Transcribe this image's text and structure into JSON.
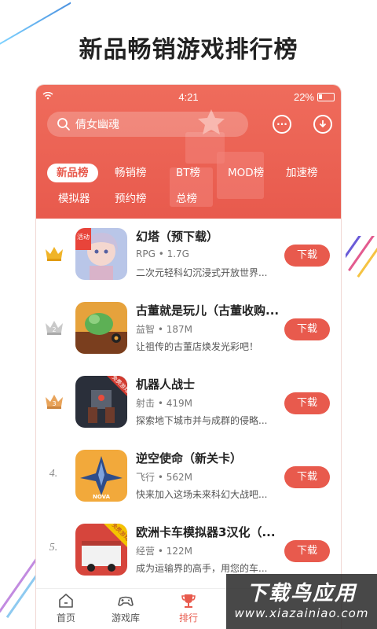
{
  "headline": "新品畅销游戏排行榜",
  "statusbar": {
    "time": "4:21",
    "battery": "22%"
  },
  "search": {
    "placeholder": "倩女幽魂"
  },
  "tabs": [
    {
      "label": "新品榜",
      "active": true
    },
    {
      "label": "畅销榜",
      "active": false
    },
    {
      "label": "BT榜",
      "active": false
    },
    {
      "label": "MOD榜",
      "active": false
    },
    {
      "label": "加速榜",
      "active": false
    },
    {
      "label": "模拟器",
      "active": false
    },
    {
      "label": "预约榜",
      "active": false
    },
    {
      "label": "总榜",
      "active": false
    }
  ],
  "apps": [
    {
      "rank": "1",
      "name": "幻塔（预下载）",
      "meta": "RPG • 1.7G",
      "desc": "二次元轻科幻沉浸式开放世界...",
      "button": "下载",
      "badge": "活动"
    },
    {
      "rank": "2",
      "name": "古董就是玩儿（古董收购...",
      "meta": "益智 • 187M",
      "desc": "让祖传的古董店焕发光彩吧！",
      "button": "下载"
    },
    {
      "rank": "3",
      "name": "机器人战士",
      "meta": "射击 • 419M",
      "desc": "探索地下城市并与成群的侵略...",
      "button": "下载",
      "badge": "免费游戏"
    },
    {
      "rank": "4.",
      "name": "逆空使命（新关卡）",
      "meta": "飞行 • 562M",
      "desc": "快来加入这场未来科幻大战吧...",
      "button": "下载",
      "badge": "NOVA"
    },
    {
      "rank": "5.",
      "name": "欧洲卡车模拟器3汉化（...",
      "meta": "经营 • 122M",
      "desc": "成为运输界的高手，用您的车...",
      "button": "下载",
      "badge": "免费游戏"
    }
  ],
  "nav": [
    {
      "label": "首页",
      "active": false
    },
    {
      "label": "游戏库",
      "active": false
    },
    {
      "label": "排行",
      "active": true
    }
  ],
  "watermark": {
    "title": "下载鸟应用",
    "url": "www.xiazainiao.com"
  },
  "colors": {
    "accent": "#e85a4d",
    "gold": "#f0b429",
    "silver": "#c9c9c9",
    "bronze": "#e8a35a"
  }
}
